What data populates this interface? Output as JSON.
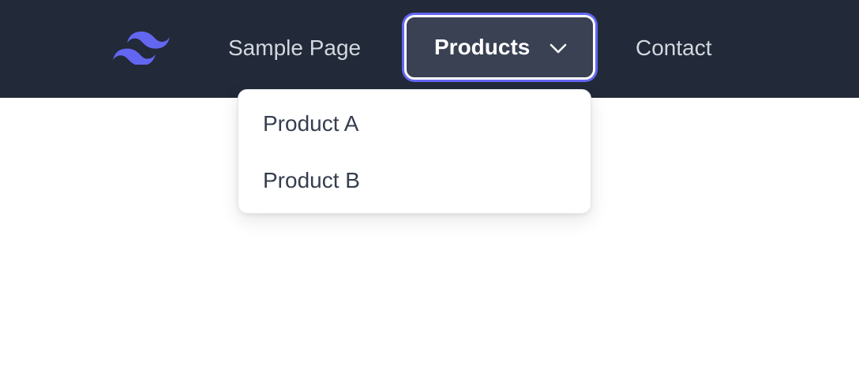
{
  "navbar": {
    "logo_icon": "tailwind-wave-logo-icon",
    "links": {
      "sample_page": "Sample Page",
      "products": "Products",
      "contact": "Contact"
    },
    "products_chevron_icon": "chevron-down-icon"
  },
  "dropdown": {
    "items": [
      {
        "label": "Product A"
      },
      {
        "label": "Product B"
      }
    ]
  },
  "colors": {
    "navbar_bg": "#222938",
    "active_button_bg": "#394153",
    "focus_ring": "#6366f1",
    "logo": "#6366f1",
    "nav_text": "#d3d7df",
    "dropdown_text": "#353e4f"
  }
}
